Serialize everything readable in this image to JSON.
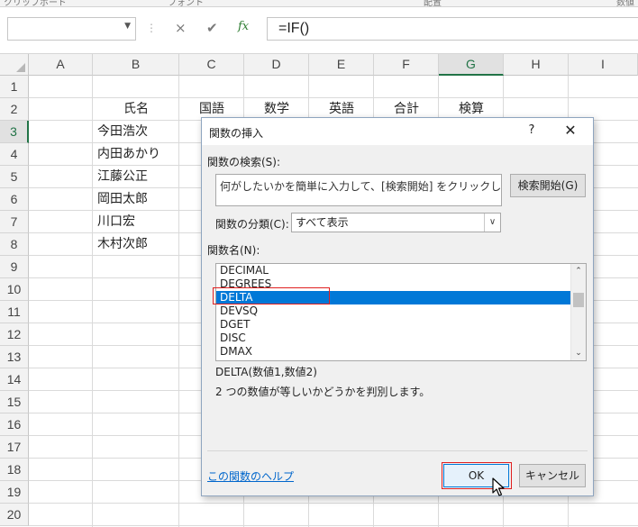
{
  "ribbon": {
    "groups": [
      "クリップボード",
      "フォント",
      "配置",
      "数値"
    ]
  },
  "formula_bar": {
    "name_box_value": "",
    "cancel_icon": "×",
    "enter_icon": "✔",
    "fx_icon": "fx",
    "formula": "=IF()"
  },
  "sheet": {
    "columns": [
      "A",
      "B",
      "C",
      "D",
      "E",
      "F",
      "G",
      "H",
      "I"
    ],
    "selected_column": "G",
    "selected_row": "3",
    "rows": [
      "1",
      "2",
      "3",
      "4",
      "5",
      "6",
      "7",
      "8",
      "9",
      "10",
      "11",
      "12",
      "13",
      "14",
      "15",
      "16",
      "17",
      "18",
      "19",
      "20"
    ],
    "headers": {
      "B": "氏名",
      "C": "国語",
      "D": "数学",
      "E": "英語",
      "F": "合計",
      "G": "検算"
    },
    "names": [
      "今田浩次",
      "内田あかり",
      "江藤公正",
      "岡田太郎",
      "川口宏",
      "木村次郎"
    ]
  },
  "dialog": {
    "title": "関数の挿入",
    "help_button": "?",
    "close_button": "✕",
    "search_label": "関数の検索(S):",
    "search_text": "何がしたいかを簡単に入力して、[検索開始] をクリックしてください。",
    "search_button": "検索開始(G)",
    "category_label": "関数の分類(C):",
    "category_value": "すべて表示",
    "function_name_label": "関数名(N):",
    "functions": [
      "DECIMAL",
      "DEGREES",
      "DELTA",
      "DEVSQ",
      "DGET",
      "DISC",
      "DMAX"
    ],
    "selected_function": "DELTA",
    "syntax": "DELTA(数値1,数値2)",
    "description": "2 つの数値が等しいかどうかを判別します。",
    "help_link": "この関数のヘルプ",
    "ok_button": "OK",
    "cancel_button": "キャンセル"
  },
  "colors": {
    "selection_blue": "#0078d7",
    "excel_green": "#217346",
    "highlight_red": "#e02020"
  }
}
